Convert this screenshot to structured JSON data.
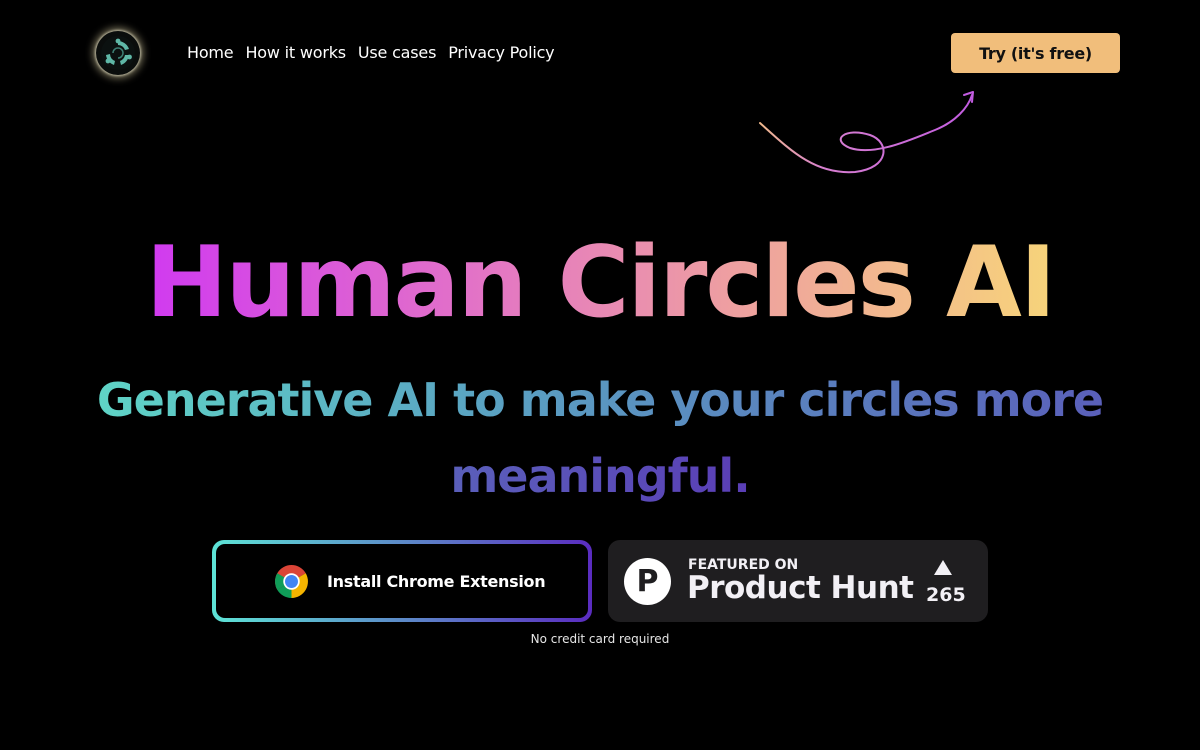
{
  "brand": {
    "logo_icon": "human-circles-logo-icon",
    "name": "Human Circles AI"
  },
  "nav": {
    "items": [
      {
        "label": "Home"
      },
      {
        "label": "How it works"
      },
      {
        "label": "Use cases"
      },
      {
        "label": "Privacy Policy"
      }
    ],
    "cta_label": "Try (it's free)"
  },
  "hero": {
    "title": "Human Circles AI",
    "subtitle": "Generative AI to make your circles more meaningful."
  },
  "actions": {
    "chrome_button_label": "Install Chrome Extension",
    "chrome_icon": "chrome-icon",
    "product_hunt": {
      "featured_label": "FEATURED ON",
      "name": "Product Hunt",
      "logo_letter": "P",
      "upvote_icon": "upvote-triangle-icon",
      "upvotes": "265"
    },
    "note": "No credit card required"
  },
  "colors": {
    "background": "#000000",
    "cta": "#f1be7b",
    "title_gradient": [
      "#d03af0",
      "#e271c8",
      "#eea0a0",
      "#f7d47a"
    ],
    "subtitle_gradient": [
      "#5fd4c6",
      "#5aa2c2",
      "#5a78bd",
      "#5a3eb6"
    ],
    "chrome_border_gradient": [
      "#5de3d6",
      "#5c8ac8",
      "#5a2cc0"
    ],
    "product_hunt_bg": "#1f1e20"
  }
}
